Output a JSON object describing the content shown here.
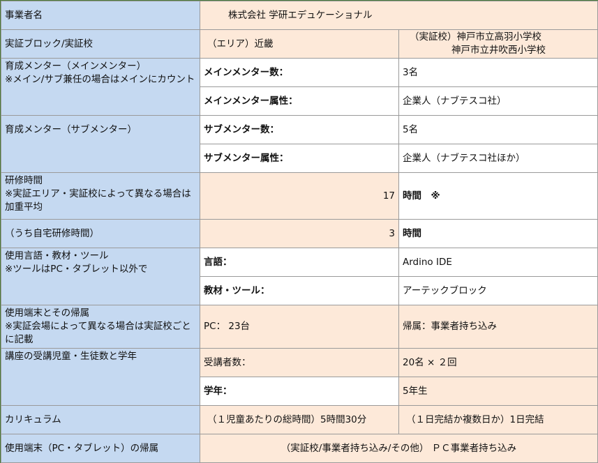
{
  "rows": {
    "operator": {
      "label": "事業者名",
      "value": "株式会社 学研エデュケーショナル"
    },
    "block": {
      "label": "実証ブロック/実証校",
      "area": "（エリア）近畿",
      "school_line1": "（実証校）神戸市立高羽小学校",
      "school_line2": "神戸市立井吹西小学校"
    },
    "main_mentor": {
      "label_line1": "育成メンター（メインメンター）",
      "label_line2": "※メイン/サブ兼任の場合はメインにカウント",
      "count_label": "メインメンター数：",
      "count_value": "3名",
      "attr_label": "メインメンター属性：",
      "attr_value": "企業人（ナブテスコ社）"
    },
    "sub_mentor": {
      "label": "育成メンター（サブメンター）",
      "count_label": "サブメンター数：",
      "count_value": "5名",
      "attr_label": "サブメンター属性：",
      "attr_value": "企業人（ナブテスコ社ほか）"
    },
    "training": {
      "label_line1": "研修時間",
      "label_line2": "※実証エリア・実証校によって異なる場合は加重平均",
      "hours": "17",
      "unit": "時間　※"
    },
    "home_training": {
      "label": "（うち自宅研修時間）",
      "hours": "3",
      "unit": "時間"
    },
    "language": {
      "label_line1": "使用言語・教材・ツール",
      "label_line2": "※ツールはPC・タブレット以外で",
      "lang_label": "言語：",
      "lang_value": "Ardino IDE",
      "tool_label": "教材・ツール：",
      "tool_value": "アーテックブロック"
    },
    "device": {
      "label_line1": "使用端末とその帰属",
      "label_line2": "※実証会場によって異なる場合は実証校ごとに記載",
      "pc": "PC： 23台",
      "belong": "帰属：事業者持ち込み"
    },
    "students": {
      "label": "講座の受講児童・生徒数と学年",
      "count_label": "受講者数：",
      "count_value": "20名 × ２回",
      "grade_label": "学年：",
      "grade_value": "5年生"
    },
    "curriculum": {
      "label": "カリキュラム",
      "total": "（１児童あたりの総時間）5時間30分",
      "days": "（１日完結か複数日か）1日完結"
    },
    "device_owner": {
      "label": "使用端末（PC・タブレット）の帰属",
      "value": "（実証校/事業者持ち込み/その他） ＰＣ事業者持ち込み"
    }
  }
}
